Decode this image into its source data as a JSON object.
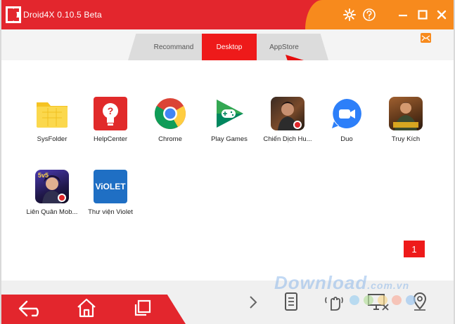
{
  "window": {
    "title": "Droid4X 0.10.5 Beta"
  },
  "titlebar": {
    "settings": "gear-icon",
    "help": "help-icon",
    "minimize": "minimize-icon",
    "maximize": "maximize-icon",
    "close": "close-icon"
  },
  "tabs": [
    {
      "label": "Recommand"
    },
    {
      "label": "Desktop"
    },
    {
      "label": "AppStore"
    }
  ],
  "active_tab": "Desktop",
  "apps": [
    {
      "label": "SysFolder"
    },
    {
      "label": "HelpCenter"
    },
    {
      "label": "Chrome"
    },
    {
      "label": "Play Games"
    },
    {
      "label": "Chiến Dịch Hu..."
    },
    {
      "label": "Duo"
    },
    {
      "label": "Truy Kích"
    },
    {
      "label": "Liên Quân Mob..."
    },
    {
      "label": "Thư viện Violet"
    }
  ],
  "icon_texts": {
    "violet": "ViOLET",
    "lq": "5v5"
  },
  "page_number": "1",
  "watermark": {
    "main": "Download",
    "suffix": ".com.vn"
  },
  "colors": {
    "red": "#e3262d",
    "orange": "#f78a1d",
    "tab_active": "#ee1a1a"
  }
}
